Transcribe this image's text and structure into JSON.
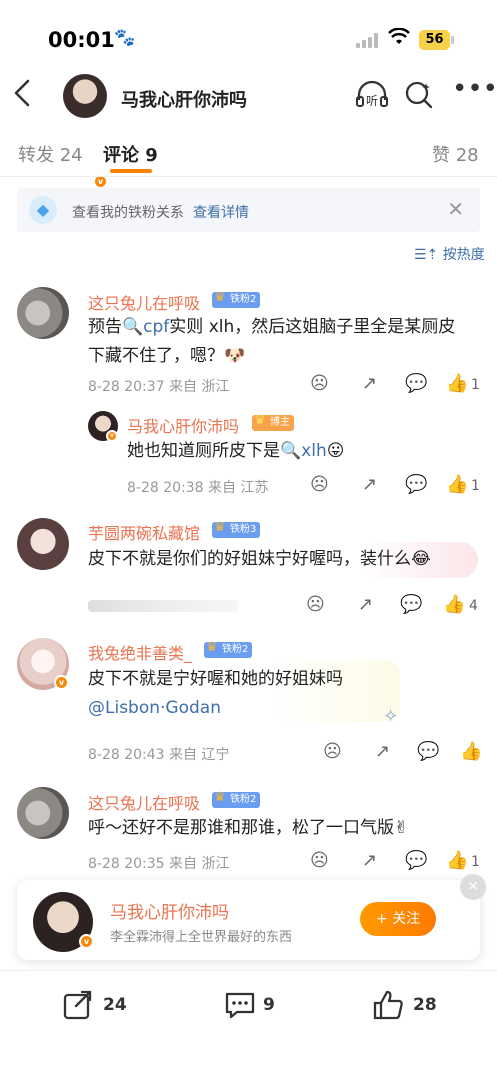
{
  "status": {
    "time": "00:01",
    "battery": "56"
  },
  "nav": {
    "title": "马我心肝你沛吗",
    "listen_icon": "听"
  },
  "tabs": {
    "repost": "转发 24",
    "comment": "评论 9",
    "like": "赞 28"
  },
  "fan_banner": {
    "text": "查看我的铁粉关系",
    "link": "查看详情"
  },
  "sort": {
    "label": "按热度"
  },
  "comments": [
    {
      "name": "这只兔儿在呼吸",
      "badge": "铁粉2",
      "kw1": "cpf",
      "text_a": "预告",
      "text_b": "实则 xlh，然后这姐脑子里全是某厕皮",
      "text_c": "下藏不住了，嗯？🐶",
      "meta": "8-28 20:37 来自 浙江",
      "like": "1",
      "reply": {
        "name": "马我心肝你沛吗",
        "badge": "博主",
        "text_a": "她也知道厕所皮下是",
        "kw": "xlh",
        "emoji": "😛",
        "meta": "8-28 20:38 来自 江苏",
        "like": "1"
      }
    },
    {
      "name": "芋圆两碗私藏馆",
      "badge": "铁粉3",
      "text": "皮下不就是你们的好姐妹宁好喔吗，装什么😂",
      "like": "4"
    },
    {
      "name": "我兔绝非善类_",
      "badge": "铁粉2",
      "text_a": "皮下不就是宁好喔和她的好姐妹吗",
      "mention": "@Lisbon·Godan",
      "meta": "8-28 20:43 来自 辽宁"
    },
    {
      "name": "这只兔儿在呼吸",
      "badge": "铁粉2",
      "text": "呼～还好不是那谁和那谁，松了一口气版✌",
      "meta": "8-28 20:35 来自 浙江",
      "like": "1"
    }
  ],
  "follow_card": {
    "name": "马我心肝你沛吗",
    "desc": "李全霖沛得上全世界最好的东西",
    "button": "+ 关注"
  },
  "bottom": {
    "repost": "24",
    "comment": "9",
    "like": "28"
  },
  "colors": {
    "accent": "#ff8200",
    "link": "#3e6fa9",
    "name": "#eb7350"
  }
}
